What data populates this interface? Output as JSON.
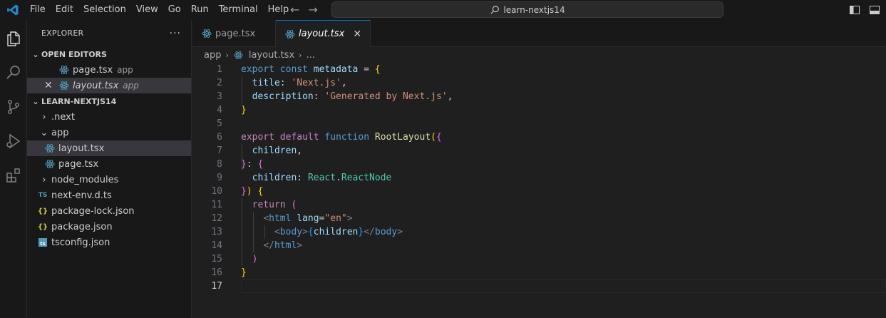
{
  "titlebar": {
    "menu": [
      "File",
      "Edit",
      "Selection",
      "View",
      "Go",
      "Run",
      "Terminal",
      "Help"
    ],
    "search_text": "learn-nextjs14"
  },
  "explorer": {
    "title": "EXPLORER",
    "more": "···",
    "open_editors_label": "OPEN EDITORS",
    "open_editors": [
      {
        "name": "page.tsx",
        "desc": "app"
      },
      {
        "name": "layout.tsx",
        "desc": "app"
      }
    ],
    "project_label": "LEARN-NEXTJS14",
    "tree": {
      "next": ".next",
      "app": "app",
      "layout": "layout.tsx",
      "page": "page.tsx",
      "node_modules": "node_modules",
      "next_env": "next-env.d.ts",
      "package_lock": "package-lock.json",
      "package": "package.json",
      "tsconfig": "tsconfig.json"
    }
  },
  "tabs": [
    {
      "label": "page.tsx"
    },
    {
      "label": "layout.tsx"
    }
  ],
  "breadcrumb": {
    "folder": "app",
    "file": "layout.tsx",
    "more": "..."
  },
  "editor": {
    "line_numbers": [
      "1",
      "2",
      "3",
      "4",
      "5",
      "6",
      "7",
      "8",
      "9",
      "10",
      "11",
      "12",
      "13",
      "14",
      "15",
      "16",
      "17"
    ],
    "lines": [
      [
        [
          "kw",
          "export"
        ],
        [
          "punc",
          " "
        ],
        [
          "kw",
          "const"
        ],
        [
          "punc",
          " "
        ],
        [
          "var",
          "metadata"
        ],
        [
          "punc",
          " = "
        ],
        [
          "b1",
          "{"
        ]
      ],
      [
        [
          "punc",
          "  "
        ],
        [
          "var",
          "title"
        ],
        [
          "punc",
          ": "
        ],
        [
          "str",
          "'Next.js'"
        ],
        [
          "punc",
          ","
        ]
      ],
      [
        [
          "punc",
          "  "
        ],
        [
          "var",
          "description"
        ],
        [
          "punc",
          ": "
        ],
        [
          "str",
          "'Generated by Next.js'"
        ],
        [
          "punc",
          ","
        ]
      ],
      [
        [
          "b1",
          "}"
        ]
      ],
      [],
      [
        [
          "ctl",
          "export"
        ],
        [
          "punc",
          " "
        ],
        [
          "ctl",
          "default"
        ],
        [
          "punc",
          " "
        ],
        [
          "kw",
          "function"
        ],
        [
          "punc",
          " "
        ],
        [
          "fn",
          "RootLayout"
        ],
        [
          "b1",
          "("
        ],
        [
          "b2",
          "{"
        ]
      ],
      [
        [
          "punc",
          "  "
        ],
        [
          "var",
          "children"
        ],
        [
          "punc",
          ","
        ]
      ],
      [
        [
          "b2",
          "}"
        ],
        [
          "punc",
          ": "
        ],
        [
          "b2",
          "{"
        ]
      ],
      [
        [
          "punc",
          "  "
        ],
        [
          "var",
          "children"
        ],
        [
          "punc",
          ": "
        ],
        [
          "type",
          "React"
        ],
        [
          "punc",
          "."
        ],
        [
          "type",
          "ReactNode"
        ]
      ],
      [
        [
          "b2",
          "}"
        ],
        [
          "b1",
          ")"
        ],
        [
          "punc",
          " "
        ],
        [
          "b1",
          "{"
        ]
      ],
      [
        [
          "punc",
          "  "
        ],
        [
          "ctl",
          "return"
        ],
        [
          "punc",
          " "
        ],
        [
          "b2",
          "("
        ]
      ],
      [
        [
          "punc",
          "    "
        ],
        [
          "tagb",
          "<"
        ],
        [
          "tag",
          "html"
        ],
        [
          "punc",
          " "
        ],
        [
          "var",
          "lang"
        ],
        [
          "punc",
          "="
        ],
        [
          "str",
          "\"en\""
        ],
        [
          "tagb",
          ">"
        ]
      ],
      [
        [
          "punc",
          "      "
        ],
        [
          "tagb",
          "<"
        ],
        [
          "tag",
          "body"
        ],
        [
          "tagb",
          ">"
        ],
        [
          "b3",
          "{"
        ],
        [
          "var",
          "children"
        ],
        [
          "b3",
          "}"
        ],
        [
          "tagb",
          "</"
        ],
        [
          "tag",
          "body"
        ],
        [
          "tagb",
          ">"
        ]
      ],
      [
        [
          "punc",
          "    "
        ],
        [
          "tagb",
          "</"
        ],
        [
          "tag",
          "html"
        ],
        [
          "tagb",
          ">"
        ]
      ],
      [
        [
          "punc",
          "  "
        ],
        [
          "b2",
          ")"
        ]
      ],
      [
        [
          "b1",
          "}"
        ]
      ],
      []
    ]
  }
}
